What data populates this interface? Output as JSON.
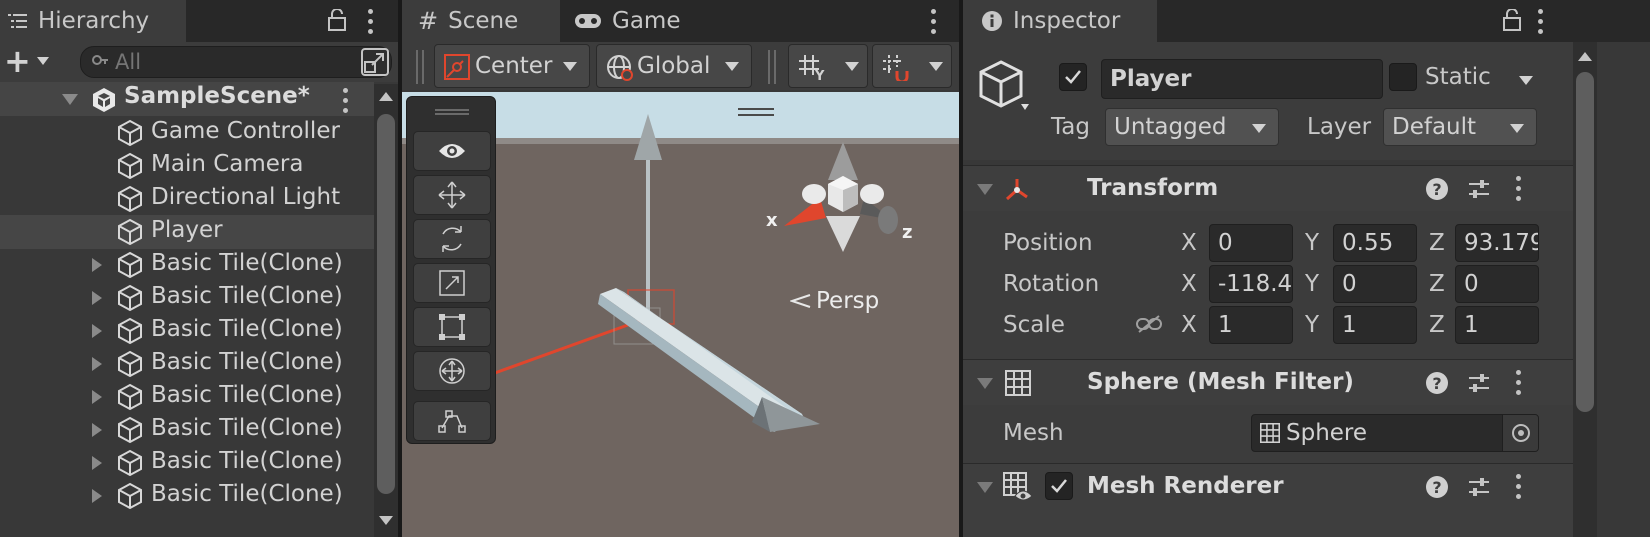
{
  "hierarchy": {
    "tab_label": "Hierarchy",
    "search_placeholder": "All",
    "add_label": "+",
    "scene_name": "SampleScene*",
    "items": [
      {
        "label": "Game Controller",
        "expandable": false,
        "selected": false
      },
      {
        "label": "Main Camera",
        "expandable": false,
        "selected": false
      },
      {
        "label": "Directional Light",
        "expandable": false,
        "selected": false
      },
      {
        "label": "Player",
        "expandable": false,
        "selected": true
      },
      {
        "label": "Basic Tile(Clone)",
        "expandable": true,
        "selected": false
      },
      {
        "label": "Basic Tile(Clone)",
        "expandable": true,
        "selected": false
      },
      {
        "label": "Basic Tile(Clone)",
        "expandable": true,
        "selected": false
      },
      {
        "label": "Basic Tile(Clone)",
        "expandable": true,
        "selected": false
      },
      {
        "label": "Basic Tile(Clone)",
        "expandable": true,
        "selected": false
      },
      {
        "label": "Basic Tile(Clone)",
        "expandable": true,
        "selected": false
      },
      {
        "label": "Basic Tile(Clone)",
        "expandable": true,
        "selected": false
      },
      {
        "label": "Basic Tile(Clone)",
        "expandable": true,
        "selected": false
      }
    ]
  },
  "scene": {
    "tab_scene": "Scene",
    "tab_game": "Game",
    "pivot_mode": "Center",
    "pivot_rotation": "Global",
    "projection_label": "Persp",
    "gizmo_x": "x",
    "gizmo_z": "z",
    "tools": [
      "view-tool",
      "move-tool",
      "rotate-tool",
      "scale-tool",
      "rect-tool",
      "transform-tool",
      "custom-tool"
    ]
  },
  "inspector": {
    "tab_label": "Inspector",
    "object_name": "Player",
    "active": true,
    "static_label": "Static",
    "tag_label": "Tag",
    "tag_value": "Untagged",
    "layer_label": "Layer",
    "layer_value": "Default",
    "transform": {
      "title": "Transform",
      "position_label": "Position",
      "rotation_label": "Rotation",
      "scale_label": "Scale",
      "axis_x": "X",
      "axis_y": "Y",
      "axis_z": "Z",
      "position": {
        "x": "0",
        "y": "0.55",
        "z": "93.179"
      },
      "rotation": {
        "x": "-118.4",
        "y": "0",
        "z": "0"
      },
      "scale": {
        "x": "1",
        "y": "1",
        "z": "1"
      }
    },
    "mesh_filter": {
      "title": "Sphere (Mesh Filter)",
      "mesh_label": "Mesh",
      "mesh_value": "Sphere"
    },
    "mesh_renderer": {
      "title": "Mesh Renderer",
      "enabled": true
    }
  },
  "colors": {
    "panel_bg": "#383838",
    "tab_bg": "#282828",
    "selection": "#464646",
    "sky": "#c7dde6",
    "ground": "#6f6560",
    "axis_red": "#e0462d"
  }
}
